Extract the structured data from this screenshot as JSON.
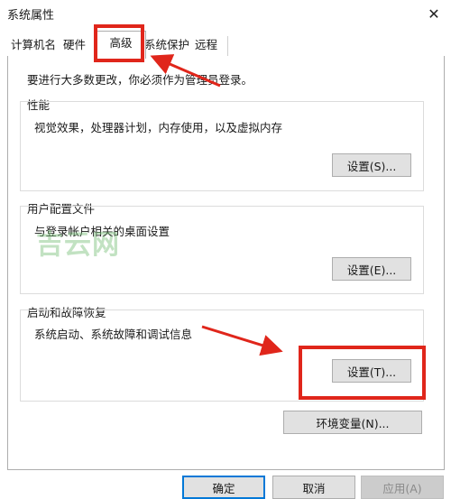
{
  "window": {
    "title": "系统属性",
    "close_glyph": "✕"
  },
  "tabs": [
    {
      "label": "计算机名",
      "active": false
    },
    {
      "label": "硬件",
      "active": false
    },
    {
      "label": "高级",
      "active": true
    },
    {
      "label": "系统保护",
      "active": false
    },
    {
      "label": "远程",
      "active": false
    }
  ],
  "admin_note": "要进行大多数更改，你必须作为管理员登录。",
  "groups": {
    "performance": {
      "label": "性能",
      "desc": "视觉效果，处理器计划，内存使用，以及虚拟内存",
      "button": "设置(S)..."
    },
    "user_profiles": {
      "label": "用户配置文件",
      "desc": "与登录帐户相关的桌面设置",
      "button": "设置(E)..."
    },
    "startup_recovery": {
      "label": "启动和故障恢复",
      "desc": "系统启动、系统故障和调试信息",
      "button": "设置(T)..."
    }
  },
  "env_button": "环境变量(N)...",
  "footer": {
    "ok": "确定",
    "cancel": "取消",
    "apply": "应用(A)"
  },
  "watermark": "吉云网",
  "annotation_color": "#e0261b"
}
